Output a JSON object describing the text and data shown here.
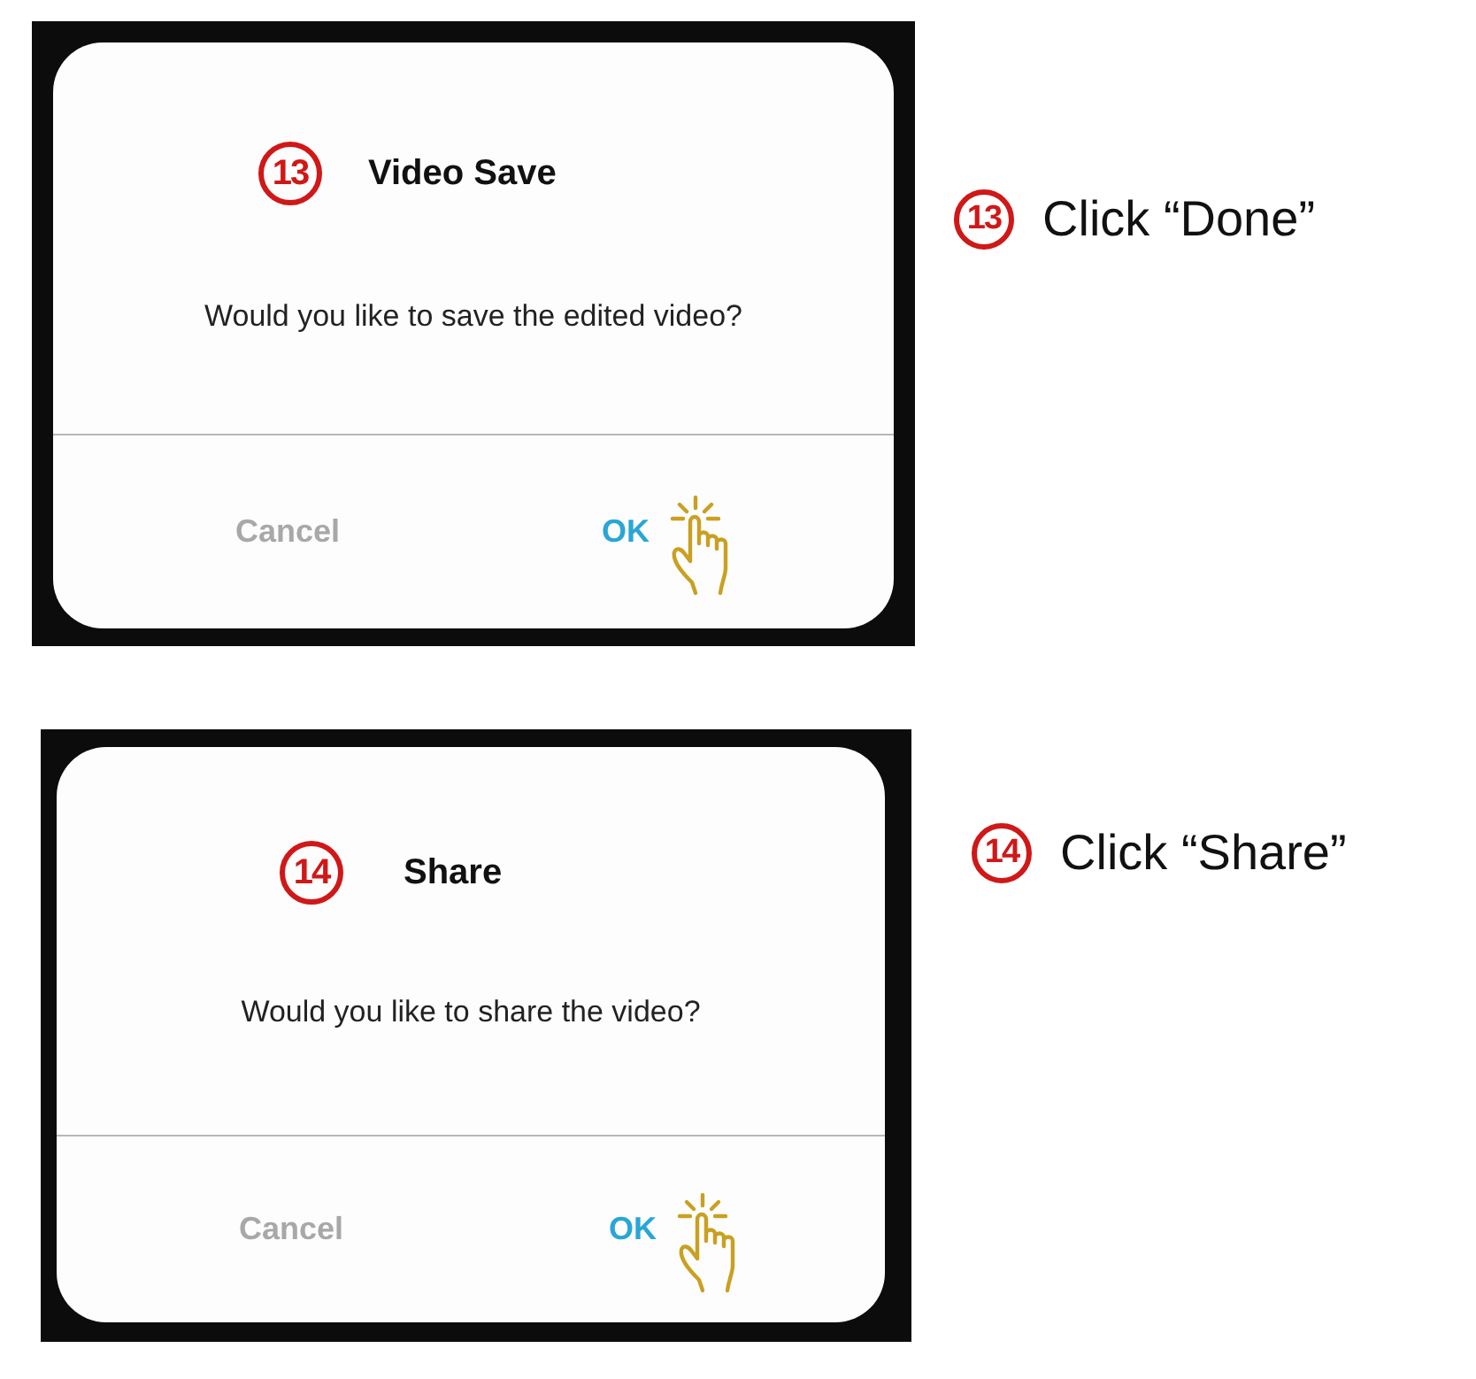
{
  "steps": [
    {
      "badge": "13",
      "title": "Video Save",
      "message": "Would you like to save the edited video?",
      "buttons": [
        {
          "label": "Cancel",
          "selected": false
        },
        {
          "label": "OK",
          "selected": true
        }
      ],
      "caption_badge": "13",
      "caption": "Click “Done”"
    },
    {
      "badge": "14",
      "title": "Share",
      "message": "Would you like to share the video?",
      "buttons": [
        {
          "label": "Cancel",
          "selected": false
        },
        {
          "label": "OK",
          "selected": true
        }
      ],
      "caption_badge": "14",
      "caption": "Click “Share”"
    }
  ]
}
